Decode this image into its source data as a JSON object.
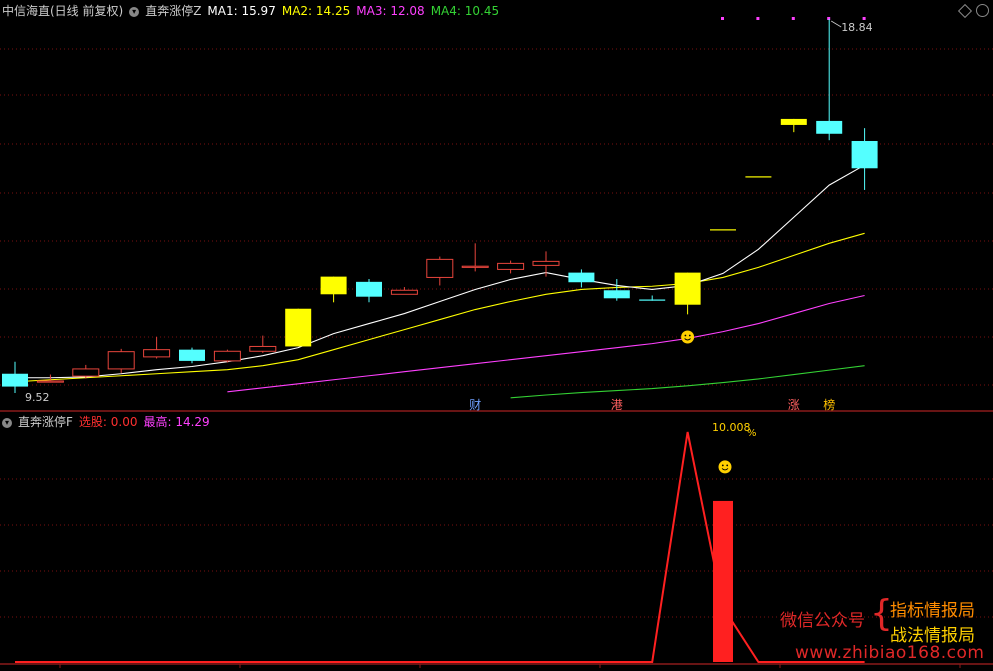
{
  "header_top": {
    "stock_name": "中信海直(日线 前复权)",
    "indicator_name": "直奔涨停Z",
    "ma1_label": "MA1: 15.97",
    "ma2_label": "MA2: 14.25",
    "ma3_label": "MA3: 12.08",
    "ma4_label": "MA4: 10.45"
  },
  "header_bottom": {
    "indicator_name": "直奔涨停F",
    "select_label": "选股: 0.00",
    "high_label": "最高: 14.29"
  },
  "colors": {
    "bg": "#000000",
    "up": "#e8453c",
    "down": "#54ffff",
    "limit_up": "#ffff00",
    "ma1": "#ffffff",
    "ma2": "#ffff00",
    "ma3": "#ff40ff",
    "ma4": "#34d234",
    "signal": "#ff2020",
    "grid": "#7a1010"
  },
  "price_labels": {
    "high": "18.84",
    "low": "9.52"
  },
  "markers": [
    {
      "index": 13,
      "text": "财",
      "color": "#6fa0ff"
    },
    {
      "index": 17,
      "text": "港",
      "color": "#ff6060"
    },
    {
      "index": 22,
      "text": "涨",
      "color": "#ff6060"
    },
    {
      "index": 23,
      "text": "榜",
      "color": "#ffc000"
    }
  ],
  "chart_data": [
    {
      "type": "candlestick",
      "candles": [
        {
          "o": 10.0,
          "h": 10.3,
          "l": 9.52,
          "c": 9.68
        },
        {
          "o": 9.82,
          "h": 9.98,
          "l": 9.78,
          "c": 9.82
        },
        {
          "o": 9.94,
          "h": 10.22,
          "l": 9.88,
          "c": 10.12
        },
        {
          "o": 10.12,
          "h": 10.62,
          "l": 10.02,
          "c": 10.55
        },
        {
          "o": 10.42,
          "h": 10.92,
          "l": 10.38,
          "c": 10.6
        },
        {
          "o": 10.6,
          "h": 10.65,
          "l": 10.26,
          "c": 10.32
        },
        {
          "o": 10.32,
          "h": 10.6,
          "l": 10.28,
          "c": 10.56
        },
        {
          "o": 10.56,
          "h": 10.95,
          "l": 10.52,
          "c": 10.68
        },
        {
          "o": 10.68,
          "h": 11.62,
          "l": 10.68,
          "c": 11.62
        },
        {
          "o": 11.98,
          "h": 12.42,
          "l": 11.78,
          "c": 12.42
        },
        {
          "o": 12.29,
          "h": 12.36,
          "l": 11.78,
          "c": 11.92
        },
        {
          "o": 11.98,
          "h": 12.16,
          "l": 11.98,
          "c": 12.08
        },
        {
          "o": 12.4,
          "h": 12.92,
          "l": 12.2,
          "c": 12.85
        },
        {
          "o": 12.68,
          "h": 13.25,
          "l": 12.55,
          "c": 12.68
        },
        {
          "o": 12.6,
          "h": 12.82,
          "l": 12.5,
          "c": 12.75
        },
        {
          "o": 12.7,
          "h": 13.05,
          "l": 12.42,
          "c": 12.8
        },
        {
          "o": 12.52,
          "h": 12.6,
          "l": 12.15,
          "c": 12.28
        },
        {
          "o": 12.08,
          "h": 12.36,
          "l": 11.82,
          "c": 11.88
        },
        {
          "o": 11.85,
          "h": 11.95,
          "l": 11.82,
          "c": 11.82
        },
        {
          "o": 11.72,
          "h": 12.52,
          "l": 11.48,
          "c": 12.52
        },
        {
          "o": 13.6,
          "h": 13.6,
          "l": 13.6,
          "c": 13.6
        },
        {
          "o": 14.92,
          "h": 14.92,
          "l": 14.92,
          "c": 14.92
        },
        {
          "o": 16.35,
          "h": 16.35,
          "l": 16.02,
          "c": 16.2
        },
        {
          "o": 16.3,
          "h": 18.84,
          "l": 15.82,
          "c": 15.98
        },
        {
          "o": 15.8,
          "h": 16.12,
          "l": 14.58,
          "c": 15.12
        }
      ],
      "limit_up_index": [
        8,
        9,
        19,
        20,
        21,
        22
      ],
      "ma1": [
        9.9,
        9.9,
        9.92,
        10.0,
        10.1,
        10.18,
        10.3,
        10.45,
        10.65,
        11.0,
        11.25,
        11.5,
        11.8,
        12.1,
        12.35,
        12.52,
        12.35,
        12.2,
        12.1,
        12.2,
        12.5,
        13.1,
        13.9,
        14.7,
        15.2
      ],
      "ma2": [
        9.8,
        9.85,
        9.9,
        9.95,
        10.0,
        10.05,
        10.1,
        10.2,
        10.35,
        10.6,
        10.85,
        11.1,
        11.35,
        11.6,
        11.8,
        11.98,
        12.1,
        12.15,
        12.18,
        12.25,
        12.4,
        12.65,
        12.95,
        13.25,
        13.5
      ],
      "ma3": [
        null,
        null,
        null,
        null,
        null,
        null,
        9.55,
        9.65,
        9.75,
        9.85,
        9.95,
        10.05,
        10.15,
        10.25,
        10.35,
        10.45,
        10.55,
        10.65,
        10.75,
        10.88,
        11.05,
        11.25,
        11.5,
        11.75,
        11.95
      ],
      "ma4": [
        null,
        null,
        null,
        null,
        null,
        null,
        null,
        null,
        null,
        null,
        null,
        null,
        null,
        null,
        9.4,
        9.47,
        9.53,
        9.58,
        9.63,
        9.7,
        9.78,
        9.87,
        9.98,
        10.09,
        10.2
      ]
    },
    {
      "type": "line",
      "signal_line": [
        0,
        0,
        0,
        0,
        0,
        0,
        0,
        0,
        0,
        0,
        0,
        0,
        0,
        0,
        0,
        0,
        0,
        0,
        0,
        14.29,
        3.4,
        0,
        0,
        0,
        0
      ],
      "bars": [
        {
          "index": 20,
          "value": 10.008
        }
      ],
      "bar_label": "10.008",
      "bar_unit": "%"
    }
  ],
  "watermark": {
    "wechat": "微信公众号",
    "brace": "{",
    "line1": "指标情报局",
    "line2": "战法情报局",
    "url": "www.zhibiao168.com"
  }
}
